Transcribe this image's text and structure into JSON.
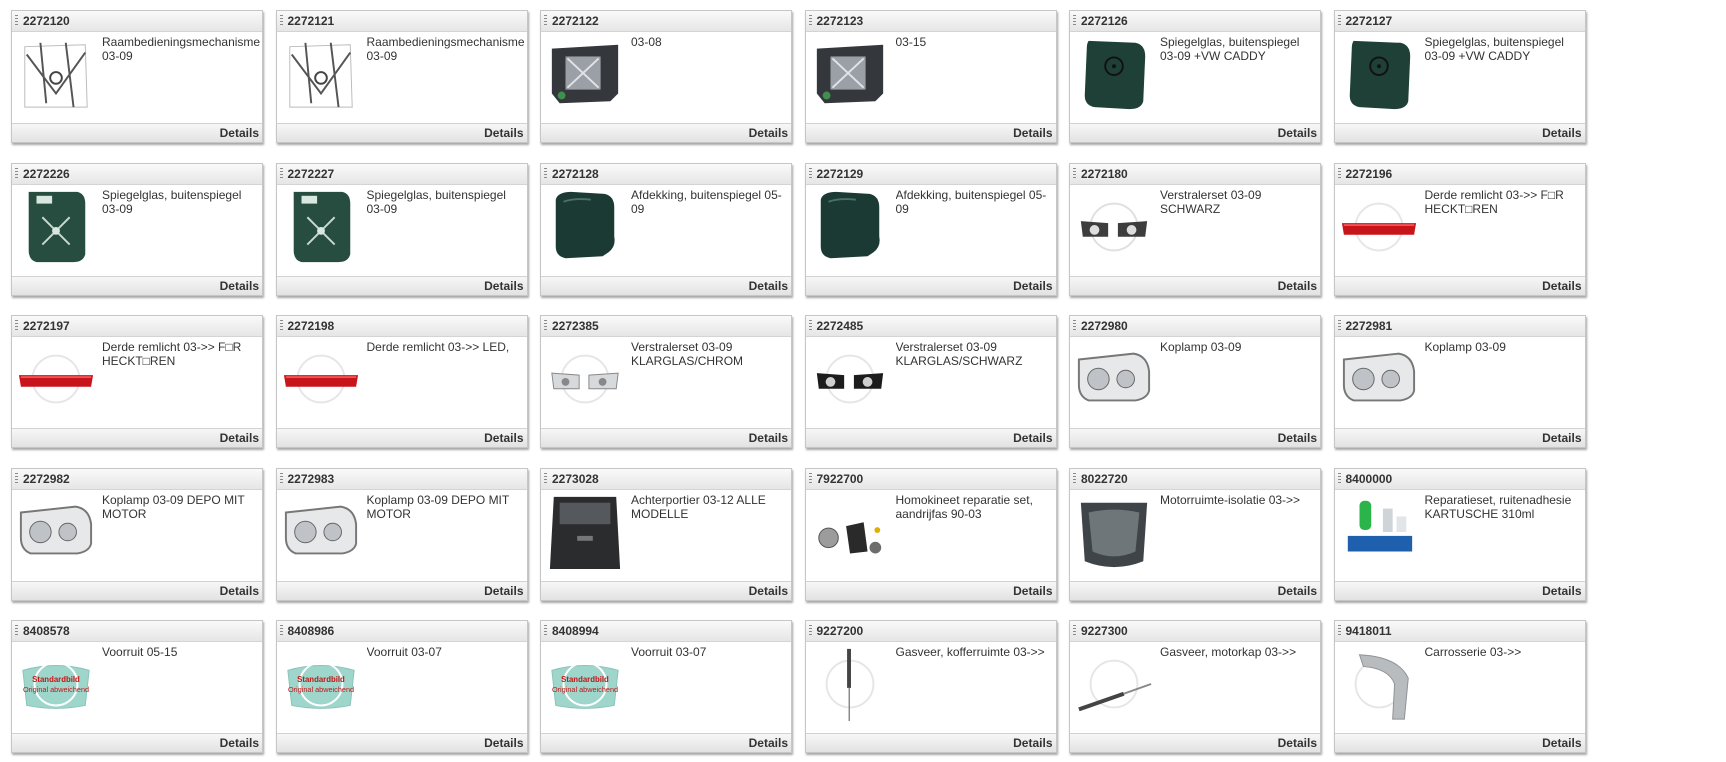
{
  "details_label": "Details",
  "placeholder_text": {
    "line1": "Standardbild",
    "line2": "Original abweichend"
  },
  "products": [
    {
      "number": "2272120",
      "description": "Raambedieningsmechanisme 03-09",
      "icon": "window-regulator-icon"
    },
    {
      "number": "2272121",
      "description": "Raambedieningsmechanisme 03-09",
      "icon": "window-regulator-icon"
    },
    {
      "number": "2272122",
      "description": "03-08",
      "icon": "door-module-icon"
    },
    {
      "number": "2272123",
      "description": "03-15",
      "icon": "door-module-icon"
    },
    {
      "number": "2272126",
      "description": "Spiegelglas, buitenspiegel 03-09 +VW CADDY",
      "icon": "mirror-glass-icon"
    },
    {
      "number": "2272127",
      "description": "Spiegelglas, buitenspiegel 03-09 +VW CADDY",
      "icon": "mirror-glass-icon"
    },
    {
      "number": "2272226",
      "description": "Spiegelglas, buitenspiegel 03-09",
      "icon": "heated-mirror-glass-icon"
    },
    {
      "number": "2272227",
      "description": "Spiegelglas, buitenspiegel 03-09",
      "icon": "heated-mirror-glass-icon"
    },
    {
      "number": "2272128",
      "description": "Afdekking, buitenspiegel 05-09",
      "icon": "mirror-cover-icon"
    },
    {
      "number": "2272129",
      "description": "Afdekking, buitenspiegel 05-09",
      "icon": "mirror-cover-icon"
    },
    {
      "number": "2272180",
      "description": "Verstralerset 03-09 SCHWARZ",
      "icon": "headlight-pair-dark-icon"
    },
    {
      "number": "2272196",
      "description": "Derde remlicht 03->> F□R HECKT□REN",
      "icon": "brake-light-icon"
    },
    {
      "number": "2272197",
      "description": "Derde remlicht 03->> F□R HECKT□REN",
      "icon": "brake-light-icon"
    },
    {
      "number": "2272198",
      "description": "Derde remlicht 03->> LED,",
      "icon": "brake-light-icon"
    },
    {
      "number": "2272385",
      "description": "Verstralerset 03-09 KLARGLAS/CHROM",
      "icon": "headlight-pair-chrome-icon"
    },
    {
      "number": "2272485",
      "description": "Verstralerset 03-09 KLARGLAS/SCHWARZ",
      "icon": "headlight-pair-black-icon"
    },
    {
      "number": "2272980",
      "description": "Koplamp 03-09",
      "icon": "headlamp-icon"
    },
    {
      "number": "2272981",
      "description": "Koplamp 03-09",
      "icon": "headlamp-icon"
    },
    {
      "number": "2272982",
      "description": "Koplamp 03-09 DEPO MIT MOTOR",
      "icon": "headlamp-icon"
    },
    {
      "number": "2272983",
      "description": "Koplamp 03-09 DEPO MIT MOTOR",
      "icon": "headlamp-icon"
    },
    {
      "number": "2273028",
      "description": "Achterportier 03-12 ALLE MODELLE",
      "icon": "tailgate-icon"
    },
    {
      "number": "7922700",
      "description": "Homokineet reparatie set, aandrijfas 90-03",
      "icon": "cv-joint-kit-icon"
    },
    {
      "number": "8022720",
      "description": "Motorruimte-isolatie 03->>",
      "icon": "engine-insulation-icon"
    },
    {
      "number": "8400000",
      "description": "Reparatieset, ruitenadhesie KARTUSCHE 310ml",
      "icon": "adhesive-kit-icon"
    },
    {
      "number": "8408578",
      "description": "Voorruit 05-15",
      "icon": "windshield-placeholder-icon"
    },
    {
      "number": "8408986",
      "description": "Voorruit 03-07",
      "icon": "windshield-placeholder-icon"
    },
    {
      "number": "8408994",
      "description": "Voorruit 03-07",
      "icon": "windshield-placeholder-icon"
    },
    {
      "number": "9227200",
      "description": "Gasveer, kofferruimte 03->>",
      "icon": "gas-strut-vertical-icon"
    },
    {
      "number": "9227300",
      "description": "Gasveer, motorkap 03->>",
      "icon": "gas-strut-diagonal-icon"
    },
    {
      "number": "9418011",
      "description": "Carrosserie 03->>",
      "icon": "body-panel-icon"
    }
  ]
}
